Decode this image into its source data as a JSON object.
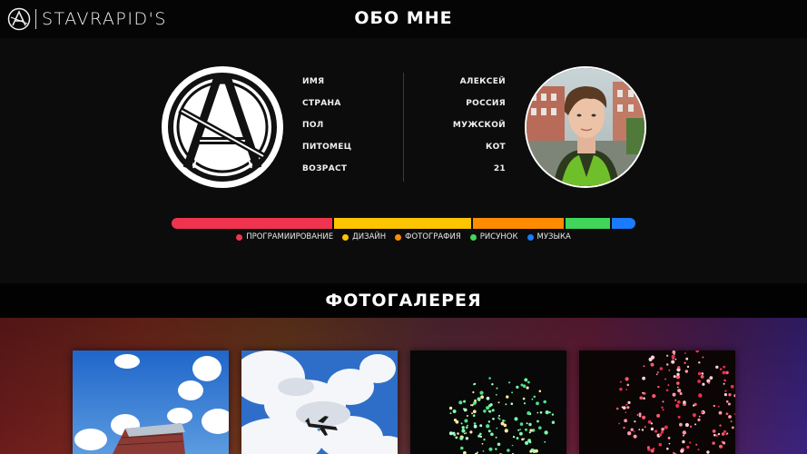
{
  "header": {
    "brand": "STAVRAPID'S",
    "title": "ОБО МНЕ"
  },
  "profile": {
    "rows": [
      {
        "label": "ИМЯ",
        "value": "АЛЕКСЕЙ"
      },
      {
        "label": "СТРАНА",
        "value": "РОССИЯ"
      },
      {
        "label": "ПОЛ",
        "value": "МУЖСКОЙ"
      },
      {
        "label": "ПИТОМЕЦ",
        "value": "КОТ"
      },
      {
        "label": "ВОЗРАСТ",
        "value": "21"
      }
    ],
    "logo_icon": "anarchy-a-icon",
    "photo_icon": "portrait-photo"
  },
  "skills": [
    {
      "name": "ПРОГРАМИИРОВАНИЕ",
      "share": 0.35,
      "color": "#f0344f"
    },
    {
      "name": "ДИЗАЙН",
      "share": 0.3,
      "color": "#fdc400"
    },
    {
      "name": "ФОТОГРАФИЯ",
      "share": 0.2,
      "color": "#ff8b00"
    },
    {
      "name": "РИСУНОК",
      "share": 0.1,
      "color": "#3fd65a"
    },
    {
      "name": "МУЗЫКА",
      "share": 0.05,
      "color": "#1a7bff"
    }
  ],
  "gallery": {
    "title": "ФОТОГАЛЕРЕЯ",
    "photos": [
      {
        "subject": "building-sky-photo"
      },
      {
        "subject": "airplane-clouds-photo"
      },
      {
        "subject": "green-fireworks-photo"
      },
      {
        "subject": "red-fireworks-photo"
      }
    ]
  }
}
